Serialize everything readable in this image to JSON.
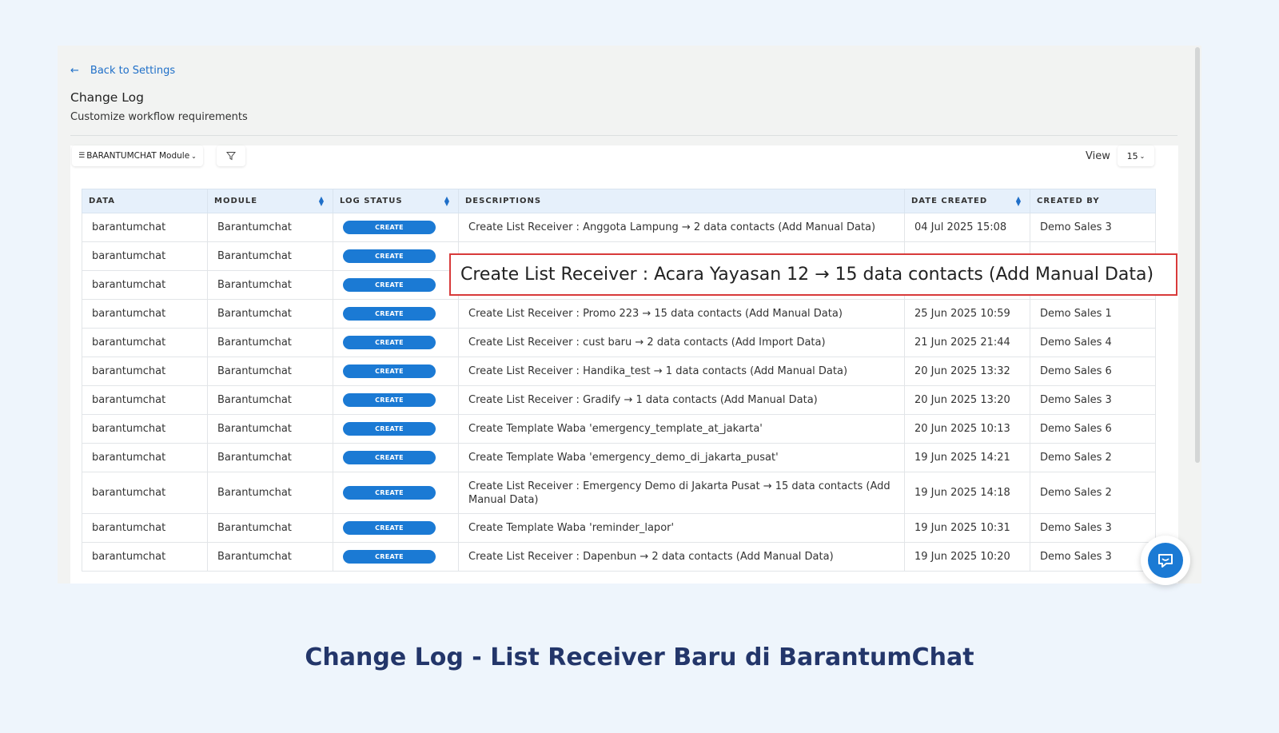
{
  "back_link": "Back to Settings",
  "page": {
    "title": "Change Log",
    "subtitle": "Customize workflow requirements"
  },
  "toolbar": {
    "module_select": "BARANTUMCHAT Module",
    "view_label": "View",
    "view_value": "15"
  },
  "table": {
    "headers": [
      "DATA",
      "MODULE",
      "LOG STATUS",
      "DESCRIPTIONS",
      "DATE CREATED",
      "CREATED BY"
    ],
    "rows": [
      {
        "data": "barantumchat",
        "module": "Barantumchat",
        "status": "CREATE",
        "desc": "Create List Receiver : Anggota Lampung → 2 data contacts (Add Manual Data)",
        "date": "04 Jul 2025 15:08",
        "by": "Demo Sales 3"
      },
      {
        "data": "barantumchat",
        "module": "Barantumchat",
        "status": "CREATE",
        "desc": "",
        "date": "",
        "by": ""
      },
      {
        "data": "barantumchat",
        "module": "Barantumchat",
        "status": "CREATE",
        "desc": "",
        "date": "",
        "by": ""
      },
      {
        "data": "barantumchat",
        "module": "Barantumchat",
        "status": "CREATE",
        "desc": "Create List Receiver : Promo 223 → 15 data contacts (Add Manual Data)",
        "date": "25 Jun 2025 10:59",
        "by": "Demo Sales 1"
      },
      {
        "data": "barantumchat",
        "module": "Barantumchat",
        "status": "CREATE",
        "desc": "Create List Receiver : cust baru → 2 data contacts (Add Import Data)",
        "date": "21 Jun 2025 21:44",
        "by": "Demo Sales 4"
      },
      {
        "data": "barantumchat",
        "module": "Barantumchat",
        "status": "CREATE",
        "desc": "Create List Receiver : Handika_test → 1 data contacts (Add Manual Data)",
        "date": "20 Jun 2025 13:32",
        "by": "Demo Sales 6"
      },
      {
        "data": "barantumchat",
        "module": "Barantumchat",
        "status": "CREATE",
        "desc": "Create List Receiver : Gradify → 1 data contacts (Add Manual Data)",
        "date": "20 Jun 2025 13:20",
        "by": "Demo Sales 3"
      },
      {
        "data": "barantumchat",
        "module": "Barantumchat",
        "status": "CREATE",
        "desc": "Create Template Waba 'emergency_template_at_jakarta'",
        "date": "20 Jun 2025 10:13",
        "by": "Demo Sales 6"
      },
      {
        "data": "barantumchat",
        "module": "Barantumchat",
        "status": "CREATE",
        "desc": "Create Template Waba 'emergency_demo_di_jakarta_pusat'",
        "date": "19 Jun 2025 14:21",
        "by": "Demo Sales 2"
      },
      {
        "data": "barantumchat",
        "module": "Barantumchat",
        "status": "CREATE",
        "desc": "Create List Receiver : Emergency Demo di Jakarta Pusat → 15 data contacts (Add Manual Data)",
        "date": "19 Jun 2025 14:18",
        "by": "Demo Sales 2"
      },
      {
        "data": "barantumchat",
        "module": "Barantumchat",
        "status": "CREATE",
        "desc": "Create Template Waba 'reminder_lapor'",
        "date": "19 Jun 2025 10:31",
        "by": "Demo Sales 3"
      },
      {
        "data": "barantumchat",
        "module": "Barantumchat",
        "status": "CREATE",
        "desc": "Create List Receiver : Dapenbun → 2 data contacts (Add Manual Data)",
        "date": "19 Jun 2025 10:20",
        "by": "Demo Sales 3"
      }
    ]
  },
  "highlight": "Create List Receiver : Acara Yayasan 12 → 15 data contacts (Add Manual Data)",
  "caption": "Change Log - List Receiver Baru di BarantumChat",
  "colors": {
    "accent": "#1b7ad4",
    "highlight_border": "#d83a3a",
    "caption": "#23366a"
  },
  "icons": [
    "arrow-left-icon",
    "filter-lines-icon",
    "chevron-down-icon",
    "funnel-icon",
    "sort-icon",
    "chat-bubble-icon"
  ]
}
